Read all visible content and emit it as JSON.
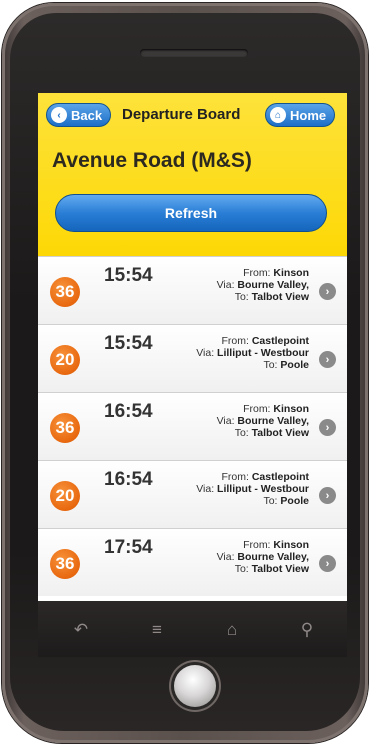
{
  "header": {
    "back_label": "Back",
    "title": "Departure Board",
    "home_label": "Home",
    "stop_name": "Avenue Road (M&S)",
    "refresh_label": "Refresh"
  },
  "departures": [
    {
      "route": "36",
      "time": "15:54",
      "from_label": "From:",
      "from": "Kinson",
      "via_label": "Via:",
      "via": "Bourne Valley,",
      "to_label": "To:",
      "to": "Talbot View"
    },
    {
      "route": "20",
      "time": "15:54",
      "from_label": "From:",
      "from": "Castlepoint",
      "via_label": "Via:",
      "via": "Lilliput - Westbour",
      "to_label": "To:",
      "to": "Poole"
    },
    {
      "route": "36",
      "time": "16:54",
      "from_label": "From:",
      "from": "Kinson",
      "via_label": "Via:",
      "via": "Bourne Valley,",
      "to_label": "To:",
      "to": "Talbot View"
    },
    {
      "route": "20",
      "time": "16:54",
      "from_label": "From:",
      "from": "Castlepoint",
      "via_label": "Via:",
      "via": "Lilliput - Westbour",
      "to_label": "To:",
      "to": "Poole"
    },
    {
      "route": "36",
      "time": "17:54",
      "from_label": "From:",
      "from": "Kinson",
      "via_label": "Via:",
      "via": "Bourne Valley,",
      "to_label": "To:",
      "to": "Talbot View"
    }
  ],
  "icons": {
    "back": "chevron-left-icon",
    "home": "house-icon",
    "row_arrow": "chevron-right-icon",
    "softkeys": [
      "back-arrow-icon",
      "menu-icon",
      "home-outline-icon",
      "search-icon"
    ]
  },
  "colors": {
    "header_bg": "#fdd806",
    "button_blue": "#1d6fc7",
    "route_badge": "#e8680f"
  }
}
